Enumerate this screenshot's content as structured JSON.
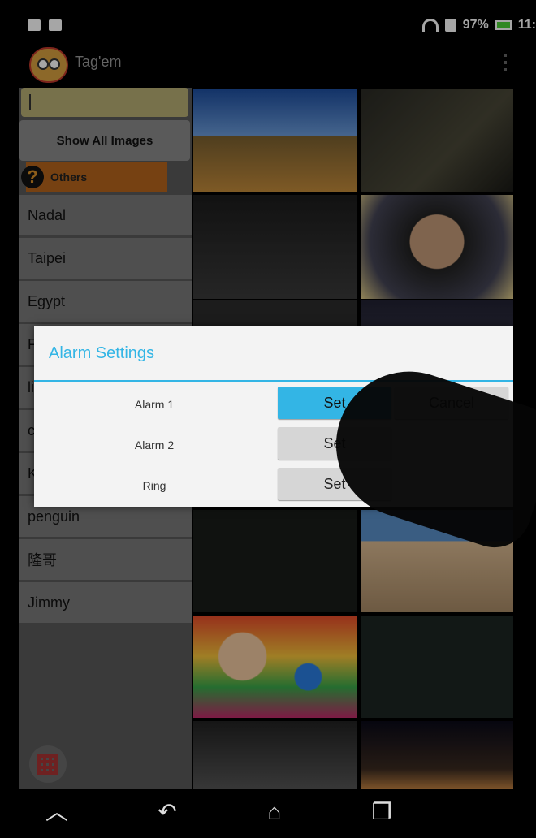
{
  "status_bar": {
    "battery": "97%",
    "time": "11:"
  },
  "app": {
    "title": "Tag'em"
  },
  "sidebar": {
    "show_all": "Show All Images",
    "others": "Others",
    "tags": [
      "Nadal",
      "Taipei",
      "Egypt",
      "F",
      "li",
      "c",
      "K",
      "penguin",
      "隆哥",
      "Jimmy"
    ]
  },
  "dialog": {
    "title": "Alarm Settings",
    "rows": [
      {
        "label": "Alarm 1",
        "set": "Set",
        "cancel": "Cancel"
      },
      {
        "label": "Alarm 2",
        "set": "Set"
      },
      {
        "label": "Ring",
        "set": "Set"
      }
    ]
  },
  "colors": {
    "accent": "#33b5e5",
    "others_tag": "#b5651d",
    "search_box": "#b7ae74"
  }
}
